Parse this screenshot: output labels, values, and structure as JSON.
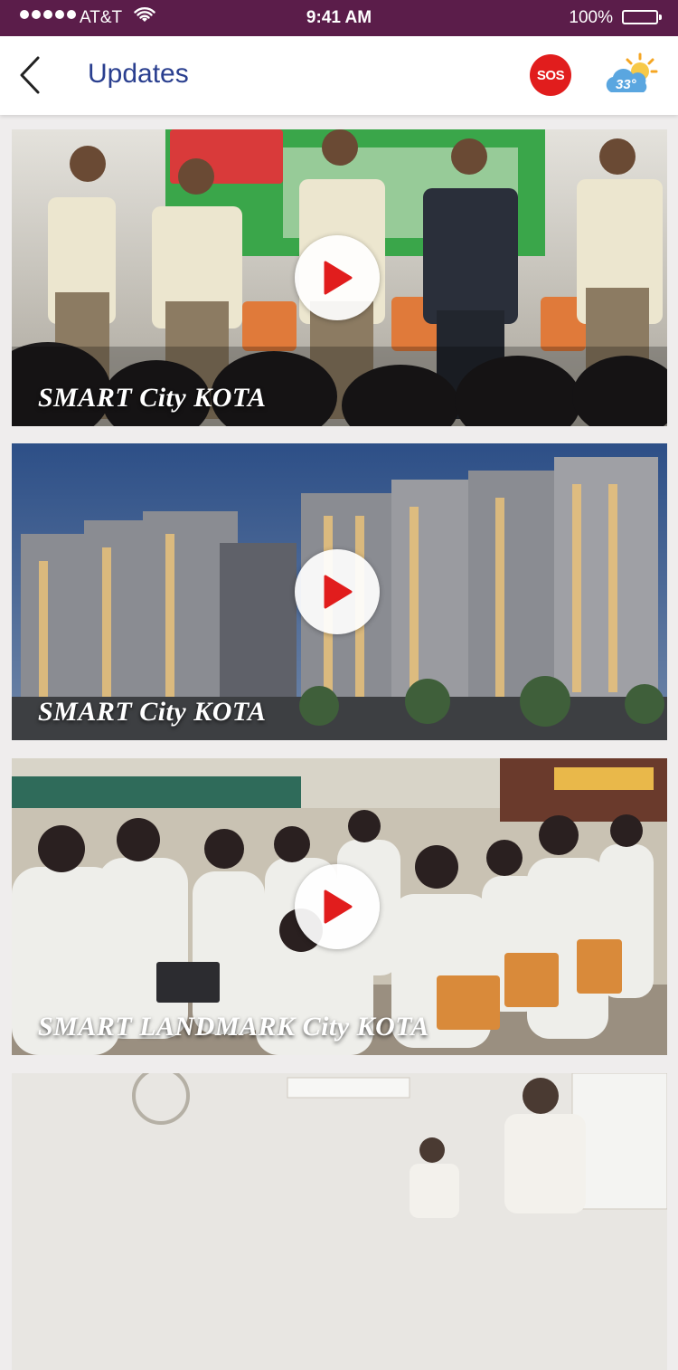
{
  "status_bar": {
    "carrier": "AT&T",
    "time": "9:41 AM",
    "battery": "100%"
  },
  "header": {
    "title": "Updates",
    "sos_label": "SOS",
    "weather_temp": "33°",
    "weather_icon": "partly-sunny-icon"
  },
  "colors": {
    "status_bar": "#5b1d4a",
    "title": "#2a3f8f",
    "sos": "#e11d1d",
    "play": "#e11d1d"
  },
  "videos": [
    {
      "title": "SMART City KOTA",
      "scene": "seminar-stage"
    },
    {
      "title": "SMART City KOTA",
      "scene": "apartment-buildings"
    },
    {
      "title": "SMART LANDMARK City KOTA",
      "scene": "students-hall"
    },
    {
      "title": "",
      "scene": "classroom"
    }
  ]
}
